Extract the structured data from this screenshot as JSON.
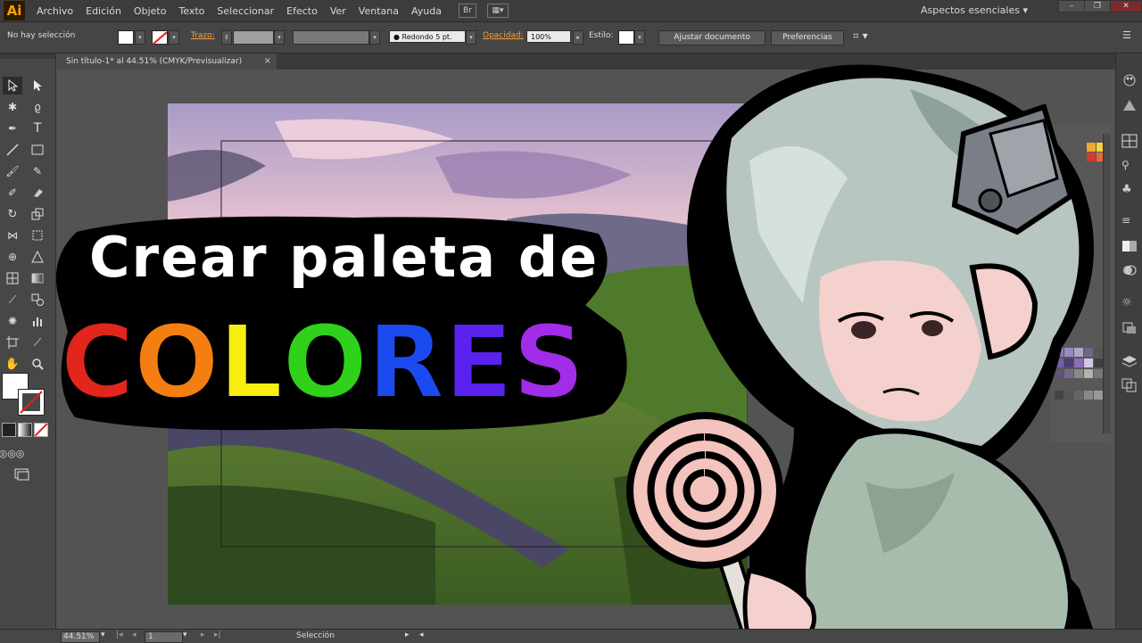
{
  "app": {
    "logo": "Ai",
    "accent": "#f7a400"
  },
  "menu": {
    "items": [
      "Archivo",
      "Edición",
      "Objeto",
      "Texto",
      "Seleccionar",
      "Efecto",
      "Ver",
      "Ventana",
      "Ayuda"
    ],
    "bridge": "Br"
  },
  "workspace": {
    "label": "Aspectos esenciales ▾"
  },
  "control_bar": {
    "selection": "No hay selección",
    "stroke_label": "Trazo:",
    "brush": "Redondo 5 pt.",
    "opacity_label": "Opacidad:",
    "opacity_value": "100%",
    "style_label": "Estilo:",
    "fit_doc_button": "Ajustar documento",
    "prefs_button": "Preferencias"
  },
  "document_tab": {
    "title": "Sin título-1* al 44.51% (CMYK/Previsualizar)",
    "close": "×"
  },
  "statusbar": {
    "zoom": "44.51%",
    "page": "1",
    "tool": "Selección"
  },
  "overlay": {
    "line1": "Crear paleta de",
    "line2_letters": [
      "C",
      "O",
      "L",
      "O",
      "R",
      "E",
      "S"
    ],
    "line2_colors": [
      "#e2261d",
      "#f57e12",
      "#f7ee12",
      "#2fd11a",
      "#1b4bf0",
      "#5a22ee",
      "#a12de8"
    ]
  },
  "icons": {
    "tools": [
      "selection-icon",
      "direct-selection-icon",
      "magic-wand-icon",
      "lasso-icon",
      "pen-icon",
      "type-icon",
      "line-icon",
      "rectangle-icon",
      "brush-icon",
      "pencil-icon",
      "blob-brush-icon",
      "eraser-icon",
      "rotate-icon",
      "scale-icon",
      "width-icon",
      "free-transform-icon",
      "shape-builder-icon",
      "perspective-icon",
      "mesh-icon",
      "gradient-icon",
      "eyedropper-icon",
      "blend-icon",
      "symbol-sprayer-icon",
      "graph-icon",
      "artboard-icon",
      "slice-icon",
      "hand-icon",
      "zoom-icon"
    ]
  }
}
